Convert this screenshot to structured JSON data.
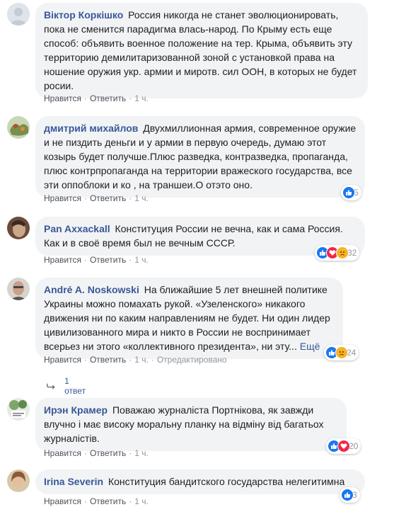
{
  "comments": [
    {
      "author": "Віктор Коркішко",
      "text": "Россия никогда не станет эволюционировать, пока не сменится парадигма влась-народ. По Крыму есть еще способ: объявить военное положение на тер. Крыма, объявить эту территорию демилитаризованной зоной с установкой права на ношение оружия укр. армии и миротв. сил ООН, в которых не будет росии.",
      "like": "Нравится",
      "reply": "Ответить",
      "time": "1 ч."
    },
    {
      "author": "дмитрий михайлов",
      "text": "Двухмиллионная армия, современное оружие и не пиздить деньги и у армии в первую очередь, думаю этот козырь будет получше.Плюс разведка, контразведка, пропаганда, плюс контрпропаганда на территории вражеского государства, все эти оппоблоки и ко , на траншеи.О отэто оно.",
      "like": "Нравится",
      "reply": "Ответить",
      "time": "1 ч.",
      "reaction_count": "5"
    },
    {
      "author": "Pan Axxackall",
      "text": "Конституция России не вечна, как и сама Россия. Как и в своё время был не вечным СССР.",
      "like": "Нравится",
      "reply": "Ответить",
      "time": "1 ч.",
      "reaction_count": "32"
    },
    {
      "author": "André A. Noskowski",
      "text": "На ближайшие 5 лет внешней политике Украины можно помахать рукой. «Узеленского» никакого движения ни по каким направлениям не будет. Ни один лидер цивилизованного мира и никто в России не воспринимает всерьез ни этого «коллективного президента», ни эту...",
      "more": "Ещё",
      "like": "Нравится",
      "reply": "Ответить",
      "time": "1 ч.",
      "edited": "Отредактировано",
      "reaction_count": "24",
      "replies_label": "1 ответ"
    },
    {
      "author": "Ирэн Крамер",
      "text": "Поважаю журналіста Портнікова, як завжди влучно і має високу моральну планку на відміну від багатьох журналістів.",
      "like": "Нравится",
      "reply": "Ответить",
      "time": "1 ч.",
      "reaction_count": "20"
    },
    {
      "author": "Irina Severin",
      "text": "Конституция бандитского государства нелегитимна",
      "like": "Нравится",
      "reply": "Ответить",
      "time": "1 ч.",
      "reaction_count": "3"
    }
  ],
  "colors": {
    "link": "#385898",
    "bubble": "#f2f3f5",
    "meta": "#90949c",
    "like": "#1877f2",
    "love": "#f0284a",
    "sad": "#f7b125"
  },
  "icons": [
    "like-icon",
    "love-icon",
    "sad-icon",
    "reply-arrow-icon"
  ]
}
